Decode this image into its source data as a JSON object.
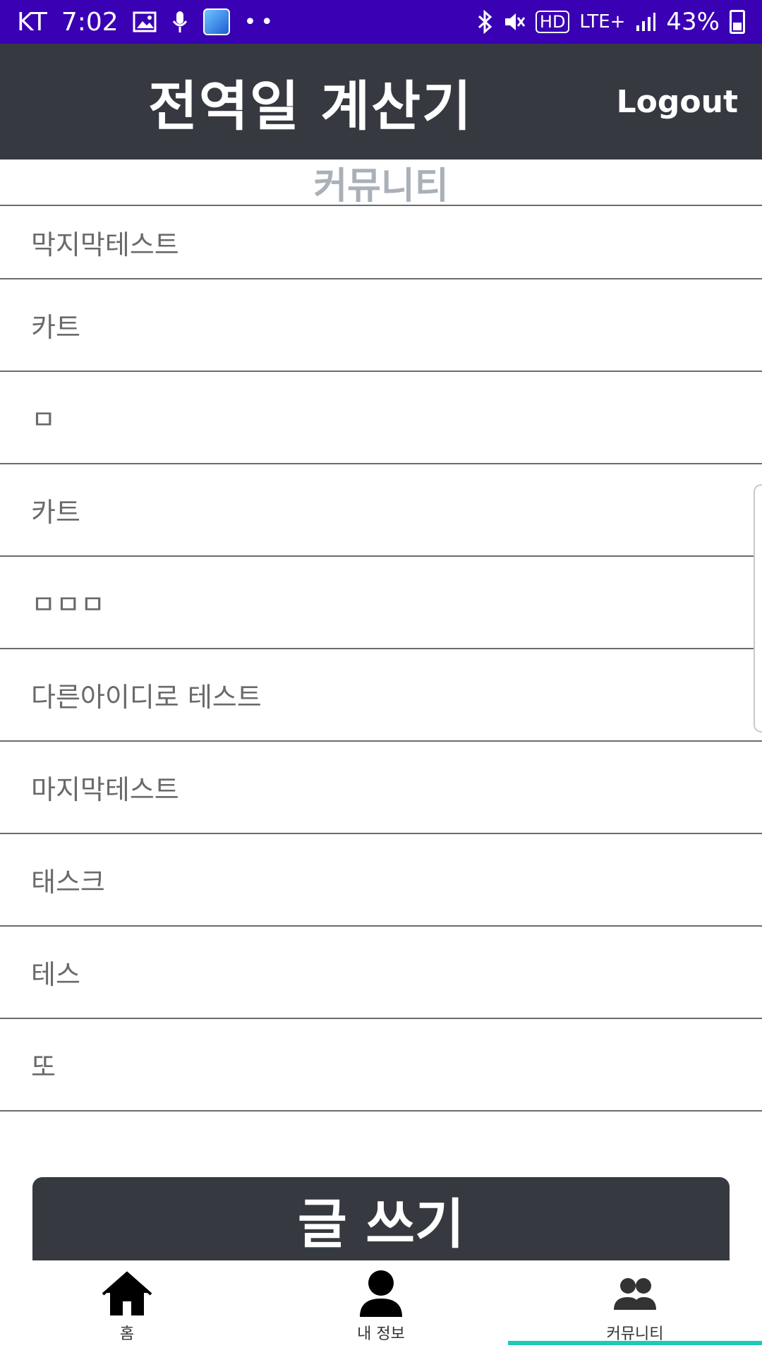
{
  "status_bar": {
    "carrier": "KT",
    "time": "7:02",
    "hd_badge": "HD",
    "network": "LTE+",
    "battery": "43%"
  },
  "header": {
    "title": "전역일 계산기",
    "logout_label": "Logout"
  },
  "section": {
    "title": "커뮤니티"
  },
  "posts": [
    "막지막테스트",
    "카트",
    "ㅁ",
    "카트",
    "ㅁㅁㅁ",
    "다른아이디로 테스트",
    "마지막테스트",
    "태스크",
    "테스",
    "또"
  ],
  "write_button": {
    "label": "글 쓰기"
  },
  "bottom_nav": {
    "tabs": [
      {
        "label": "홈",
        "icon": "home-icon"
      },
      {
        "label": "내 정보",
        "icon": "person-icon"
      },
      {
        "label": "커뮤니티",
        "icon": "group-icon"
      }
    ],
    "active_tab": "커뮤니티",
    "indicator_color": "#1dc9b7"
  },
  "colors": {
    "status_bar": "#3a00b3",
    "header": "#363a40",
    "section_title": "#a9b0b8",
    "post_text": "#6a6a6a"
  }
}
